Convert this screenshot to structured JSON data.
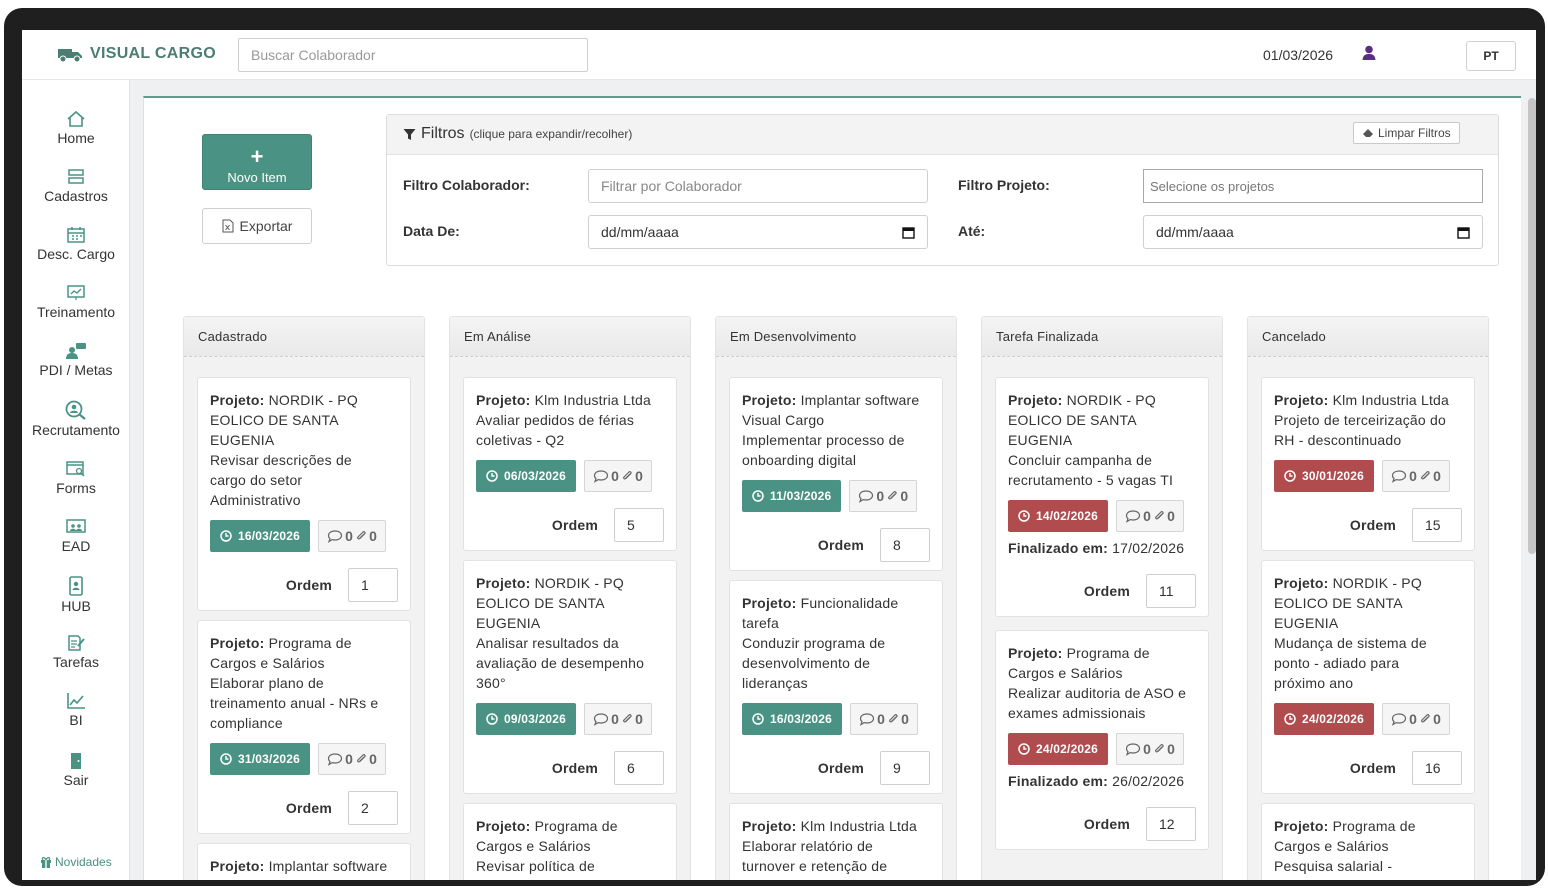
{
  "brand": {
    "name": "VISUAL CARGO"
  },
  "search": {
    "placeholder": "Buscar Colaborador"
  },
  "header": {
    "date": "01/03/2026",
    "lang": "PT"
  },
  "sidebar": {
    "items": [
      {
        "label": "Home"
      },
      {
        "label": "Cadastros"
      },
      {
        "label": "Desc. Cargo"
      },
      {
        "label": "Treinamento"
      },
      {
        "label": "PDI / Metas"
      },
      {
        "label": "Recrutamento"
      },
      {
        "label": "Forms"
      },
      {
        "label": "EAD"
      },
      {
        "label": "HUB"
      },
      {
        "label": "Tarefas"
      },
      {
        "label": "BI"
      },
      {
        "label": "Sair"
      }
    ],
    "novidades": "Novidades"
  },
  "actions": {
    "novo": "Novo Item",
    "exportar": "Exportar"
  },
  "filters": {
    "title": "Filtros",
    "hint": "(clique para expandir/recolher)",
    "clear": "Limpar Filtros",
    "colaborador_label": "Filtro Colaborador:",
    "colaborador_placeholder": "Filtrar por Colaborador",
    "projeto_label": "Filtro Projeto:",
    "projeto_placeholder": "Selecione os projetos",
    "data_de_label": "Data De:",
    "ate_label": "Até:",
    "date_placeholder": "dd/mm/aaaa"
  },
  "board": {
    "projeto_prefix": "Projeto:",
    "ordem_label": "Ordem",
    "finalizado_prefix": "Finalizado em:",
    "columns": [
      {
        "title": "Cadastrado",
        "cards": [
          {
            "project": "NORDIK - PQ",
            "lines": [
              "EOLICO DE SANTA",
              "EUGENIA",
              "Revisar descrições de",
              "cargo do setor",
              "Administrativo"
            ],
            "date": "16/03/2026",
            "comments": "0",
            "attachments": "0",
            "ordem": "1"
          },
          {
            "project": "Programa de",
            "lines": [
              "Cargos e Salários",
              "Elaborar plano de",
              "treinamento anual - NRs e",
              "compliance"
            ],
            "date": "31/03/2026",
            "comments": "0",
            "attachments": "0",
            "ordem": "2"
          },
          {
            "project": "Implantar software",
            "lines": []
          }
        ]
      },
      {
        "title": "Em Análise",
        "cards": [
          {
            "project": "Klm Industria Ltda",
            "lines": [
              "Avaliar pedidos de férias",
              "coletivas - Q2"
            ],
            "date": "06/03/2026",
            "comments": "0",
            "attachments": "0",
            "ordem": "5"
          },
          {
            "project": "NORDIK - PQ",
            "lines": [
              "EOLICO DE SANTA",
              "EUGENIA",
              "Analisar resultados da",
              "avaliação de desempenho",
              "360°"
            ],
            "date": "09/03/2026",
            "comments": "0",
            "attachments": "0",
            "ordem": "6"
          },
          {
            "project": "Programa de",
            "lines": [
              "Cargos e Salários",
              "Revisar política de"
            ]
          }
        ]
      },
      {
        "title": "Em Desenvolvimento",
        "cards": [
          {
            "project": "Implantar software",
            "lines": [
              "Visual Cargo",
              "Implementar processo de",
              "onboarding digital"
            ],
            "date": "11/03/2026",
            "comments": "0",
            "attachments": "0",
            "ordem": "8"
          },
          {
            "project": "Funcionalidade",
            "lines": [
              "tarefa",
              "Conduzir programa de",
              "desenvolvimento de",
              "lideranças"
            ],
            "date": "16/03/2026",
            "comments": "0",
            "attachments": "0",
            "ordem": "9"
          },
          {
            "project": "Klm Industria Ltda",
            "lines": [
              "Elaborar relatório de",
              "turnover e retenção de"
            ]
          }
        ]
      },
      {
        "title": "Tarefa Finalizada",
        "cards": [
          {
            "project": "NORDIK - PQ",
            "lines": [
              "EOLICO DE SANTA",
              "EUGENIA",
              "Concluir campanha de",
              "recrutamento - 5 vagas TI"
            ],
            "date": "14/02/2026",
            "comments": "0",
            "attachments": "0",
            "finalizado": "17/02/2026",
            "ordem": "11"
          },
          {
            "project": "Programa de",
            "lines": [
              "Cargos e Salários",
              "Realizar auditoria de ASO e",
              "exames admissionais"
            ],
            "date": "24/02/2026",
            "comments": "0",
            "attachments": "0",
            "finalizado": "26/02/2026",
            "ordem": "12"
          }
        ]
      },
      {
        "title": "Cancelado",
        "cards": [
          {
            "project": "Klm Industria Ltda",
            "lines": [
              "Projeto de terceirização do",
              "RH - descontinuado"
            ],
            "date": "30/01/2026",
            "comments": "0",
            "attachments": "0",
            "ordem": "15"
          },
          {
            "project": "NORDIK - PQ",
            "lines": [
              "EOLICO DE SANTA",
              "EUGENIA",
              "Mudança de sistema de",
              "ponto - adiado para",
              "próximo ano"
            ],
            "date": "24/02/2026",
            "comments": "0",
            "attachments": "0",
            "ordem": "16"
          },
          {
            "project": "Programa de",
            "lines": [
              "Cargos e Salários",
              "Pesquisa salarial -"
            ]
          }
        ]
      }
    ]
  },
  "colors": {
    "accent": "#4a9384",
    "danger": "#b04b4e"
  }
}
